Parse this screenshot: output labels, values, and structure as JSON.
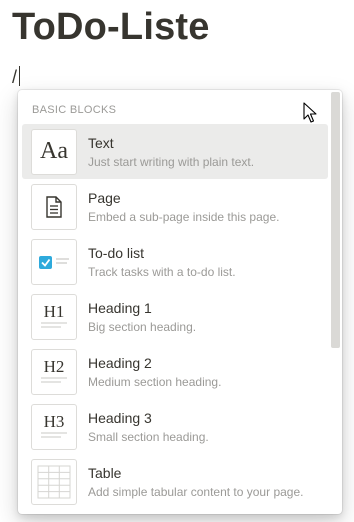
{
  "page": {
    "title": "ToDo-Liste",
    "input_text": "/"
  },
  "menu": {
    "section_label": "BASIC BLOCKS",
    "items": [
      {
        "label": "Text",
        "description": "Just start writing with plain text.",
        "icon": "text-aa-icon",
        "thumb_text": "Aa",
        "selected": true
      },
      {
        "label": "Page",
        "description": "Embed a sub-page inside this page.",
        "icon": "page-icon"
      },
      {
        "label": "To-do list",
        "description": "Track tasks with a to-do list.",
        "icon": "checkbox-icon"
      },
      {
        "label": "Heading 1",
        "description": "Big section heading.",
        "icon": "heading1-icon",
        "thumb_text": "H1"
      },
      {
        "label": "Heading 2",
        "description": "Medium section heading.",
        "icon": "heading2-icon",
        "thumb_text": "H2"
      },
      {
        "label": "Heading 3",
        "description": "Small section heading.",
        "icon": "heading3-icon",
        "thumb_text": "H3"
      },
      {
        "label": "Table",
        "description": "Add simple tabular content to your page.",
        "icon": "table-icon"
      }
    ]
  },
  "colors": {
    "text": "#37352f",
    "muted": "#9b9a97",
    "selected_bg": "#ebebea",
    "checkbox_blue": "#2eaadc"
  }
}
